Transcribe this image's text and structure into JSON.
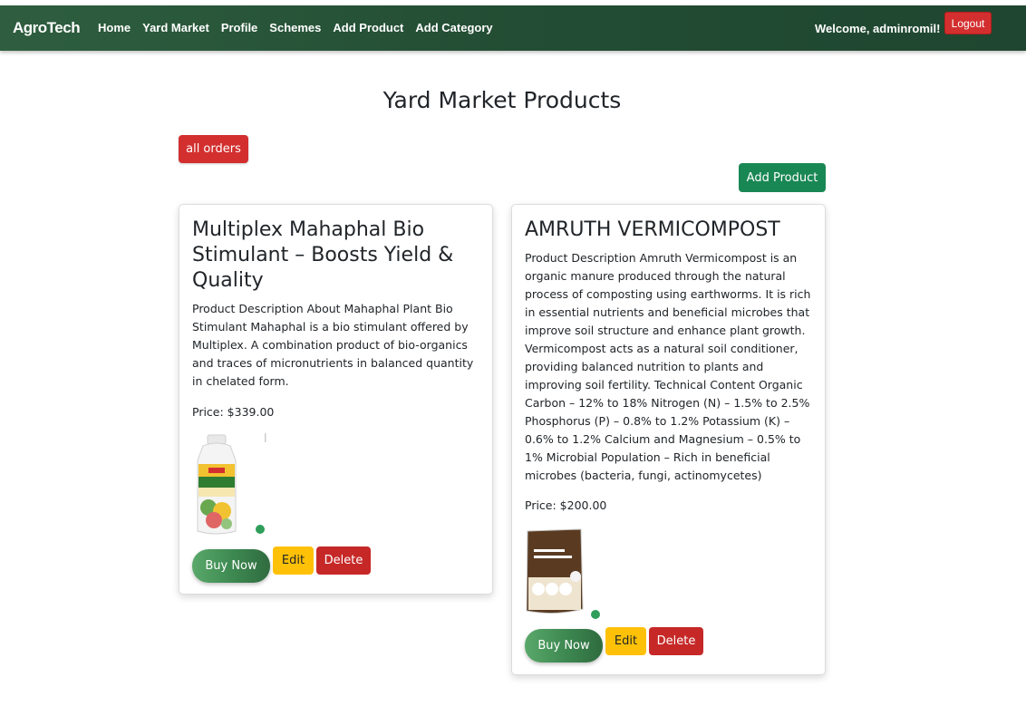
{
  "navbar": {
    "brand": "AgroTech",
    "links": [
      "Home",
      "Yard Market",
      "Profile",
      "Schemes",
      "Add Product",
      "Add Category"
    ],
    "welcome": "Welcome, adminromil!",
    "logout_label": "Logout",
    "background": "#234d34"
  },
  "page": {
    "title": "Yard Market Products",
    "all_orders_label": "all orders",
    "add_product_label": "Add Product"
  },
  "products": [
    {
      "title": "Multiplex Mahaphal Bio Stimulant – Boosts Yield & Quality",
      "description": "Product Description About Mahaphal Plant Bio Stimulant Mahaphal is a bio stimulant offered by Multiplex. A combination product of bio-organics and traces of micronutrients in balanced quantity in chelated form.",
      "price": "Price: $339.00",
      "image": "mahaphal-bottle",
      "buy_label": "Buy Now",
      "edit_label": "Edit",
      "delete_label": "Delete"
    },
    {
      "title": "AMRUTH VERMICOMPOST",
      "description": "Product Description Amruth Vermicompost is an organic manure produced through the natural process of composting using earthworms. It is rich in essential nutrients and beneficial microbes that improve soil structure and enhance plant growth. Vermicompost acts as a natural soil conditioner, providing balanced nutrition to plants and improving soil fertility. Technical Content Organic Carbon – 12% to 18% Nitrogen (N) – 1.5% to 2.5% Phosphorus (P) – 0.8% to 1.2% Potassium (K) – 0.6% to 1.2% Calcium and Magnesium – 0.5% to 1% Microbial Population – Rich in beneficial microbes (bacteria, fungi, actinomycetes)",
      "price": "Price: $200.00",
      "image": "vermicompost-bag",
      "buy_label": "Buy Now",
      "edit_label": "Edit",
      "delete_label": "Delete"
    }
  ],
  "colors": {
    "danger": "#d32f2f",
    "success": "#198754",
    "warning": "#ffc107"
  }
}
